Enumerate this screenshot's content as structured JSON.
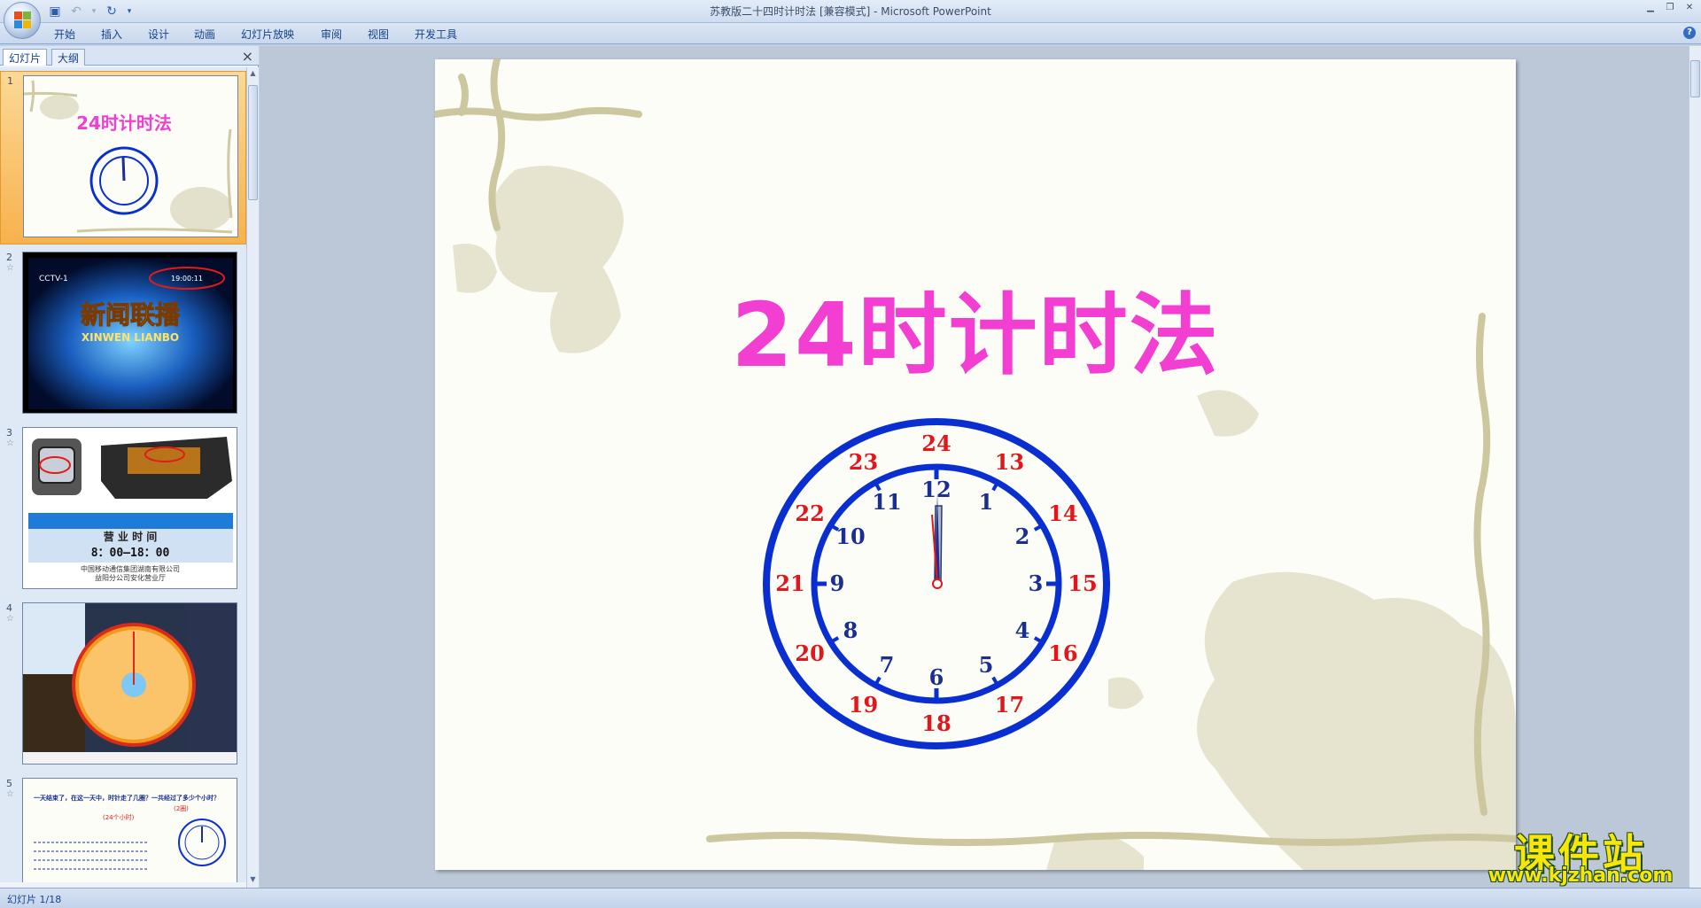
{
  "window": {
    "title": "苏教版二十四时计时法 [兼容模式] - Microsoft PowerPoint"
  },
  "ribbon": {
    "tabs": [
      "开始",
      "插入",
      "设计",
      "动画",
      "幻灯片放映",
      "审阅",
      "视图",
      "开发工具"
    ]
  },
  "left_pane": {
    "tabs": [
      "幻灯片",
      "大纲"
    ],
    "close_label": "×",
    "slides": [
      {
        "num": "1",
        "title": "24时计时法"
      },
      {
        "num": "2",
        "title": "新闻联播",
        "subtitle": "XINWEN LIANBO",
        "channel": "CCTV-1",
        "time": "19:00:11"
      },
      {
        "num": "3",
        "banner": "营 业 时 间",
        "hours": "8：00—18：00",
        "company": "中国移动通信集团湖南有限公司",
        "company2": "益阳分公司安化营业厅"
      },
      {
        "num": "4"
      },
      {
        "num": "5",
        "q1": "一天结束了，在这一天中，时针走了几圈？一共经过了多少个小时？",
        "a1": "(2圈)",
        "a2": "(24个小时)"
      }
    ]
  },
  "slide": {
    "title": "24时计时法",
    "clock_inner": [
      "12",
      "1",
      "2",
      "3",
      "4",
      "5",
      "6",
      "7",
      "8",
      "9",
      "10",
      "11"
    ],
    "clock_outer": [
      "24",
      "13",
      "14",
      "15",
      "16",
      "17",
      "18",
      "19",
      "20",
      "21",
      "22",
      "23"
    ]
  },
  "status": {
    "text": "幻灯片 1/18"
  },
  "watermark": {
    "top": "课件站",
    "bottom": "www.kjzhan.com"
  },
  "colors": {
    "title_pink": "#f23fd2",
    "clock_blue": "#0a2fd1",
    "outer_red": "#e3161b",
    "inner_blue": "#1a2f8f"
  }
}
